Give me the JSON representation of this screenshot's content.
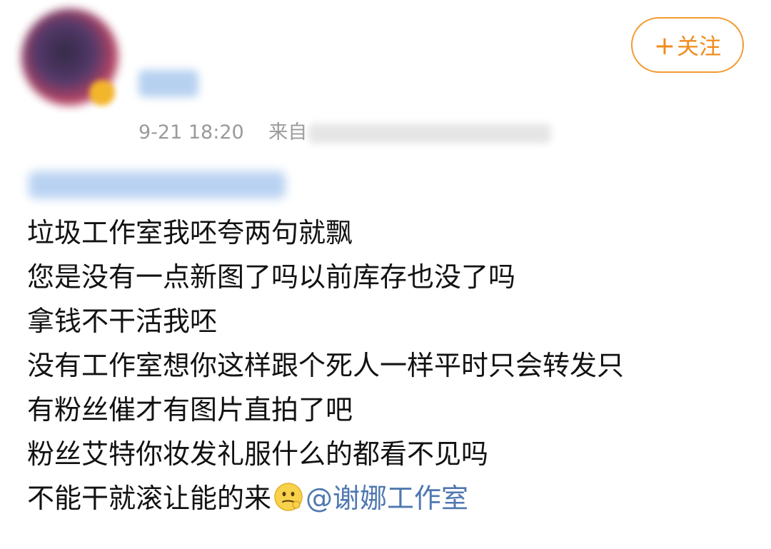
{
  "post": {
    "follow_button": {
      "plus": "+",
      "label": "关注"
    },
    "timestamp": "9-21 18:20",
    "source_prefix": "来自",
    "content": [
      "垃圾工作室我呸夸两句就飘",
      "您是没有一点新图了吗以前库存也没了吗",
      "拿钱不干活我呸",
      "没有工作室想你这样跟个死人一样平时只会转发只",
      "有粉丝催才有图片直拍了吧",
      "粉丝艾特你妆发礼服什么的都看不见吗"
    ],
    "last_line": {
      "text": "不能干就滚让能的来",
      "emoji": "smirking-face",
      "mention": "@谢娜工作室"
    }
  }
}
